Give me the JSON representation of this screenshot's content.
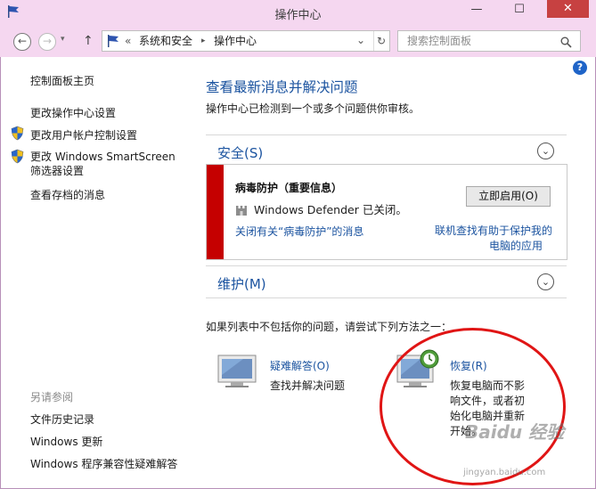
{
  "window": {
    "title": "操作中心",
    "minimize": "—",
    "maximize": "☐",
    "close": "✕"
  },
  "nav": {
    "back": "←",
    "forward": "→",
    "up": "↑",
    "breadcrumb_prefix": "«",
    "crumb1": "系统和安全",
    "crumb_sep": "▸",
    "crumb2": "操作中心",
    "dropdown": "⌄",
    "refresh": "↻",
    "search_placeholder": "搜索控制面板",
    "help": "?"
  },
  "sidebar": {
    "home": "控制面板主页",
    "items": [
      "更改操作中心设置",
      "更改用户帐户控制设置",
      "更改 Windows SmartScreen 筛选器设置",
      "查看存档的消息"
    ],
    "see_also_title": "另请参阅",
    "see_also": [
      "文件历史记录",
      "Windows 更新",
      "Windows 程序兼容性疑难解答"
    ]
  },
  "main": {
    "heading": "查看最新消息并解决问题",
    "intro": "操作中心已检测到一个或多个问题供你审核。",
    "security_title": "安全(S)",
    "security_chevron": "⌄",
    "message": {
      "title": "病毒防护（重要信息）",
      "status": "Windows Defender 已关闭。",
      "button": "立即启用(O)",
      "link_off": "关闭有关“病毒防护”的消息",
      "link_online_1": "联机查找有助于保护我的",
      "link_online_2": "电脑的应用"
    },
    "maintenance_title": "维护(M)",
    "maintenance_chevron": "⌄",
    "hint": "如果列表中不包括你的问题，请尝试下列方法之一：",
    "troubleshoot": {
      "title": "疑难解答(O)",
      "desc": "查找并解决问题"
    },
    "recovery": {
      "title": "恢复(R)",
      "desc_lines": [
        "恢复电脑而不影",
        "响文件，或者初",
        "始化电脑并重新",
        "开始。"
      ]
    }
  },
  "watermark": {
    "brand": "Baidu 经验",
    "url": "jingyan.baidu.com"
  },
  "colors": {
    "titlebar": "#f5d7f0",
    "link_blue": "#1c54a0",
    "alert_red": "#c50000",
    "annotation_red": "#e01515"
  }
}
